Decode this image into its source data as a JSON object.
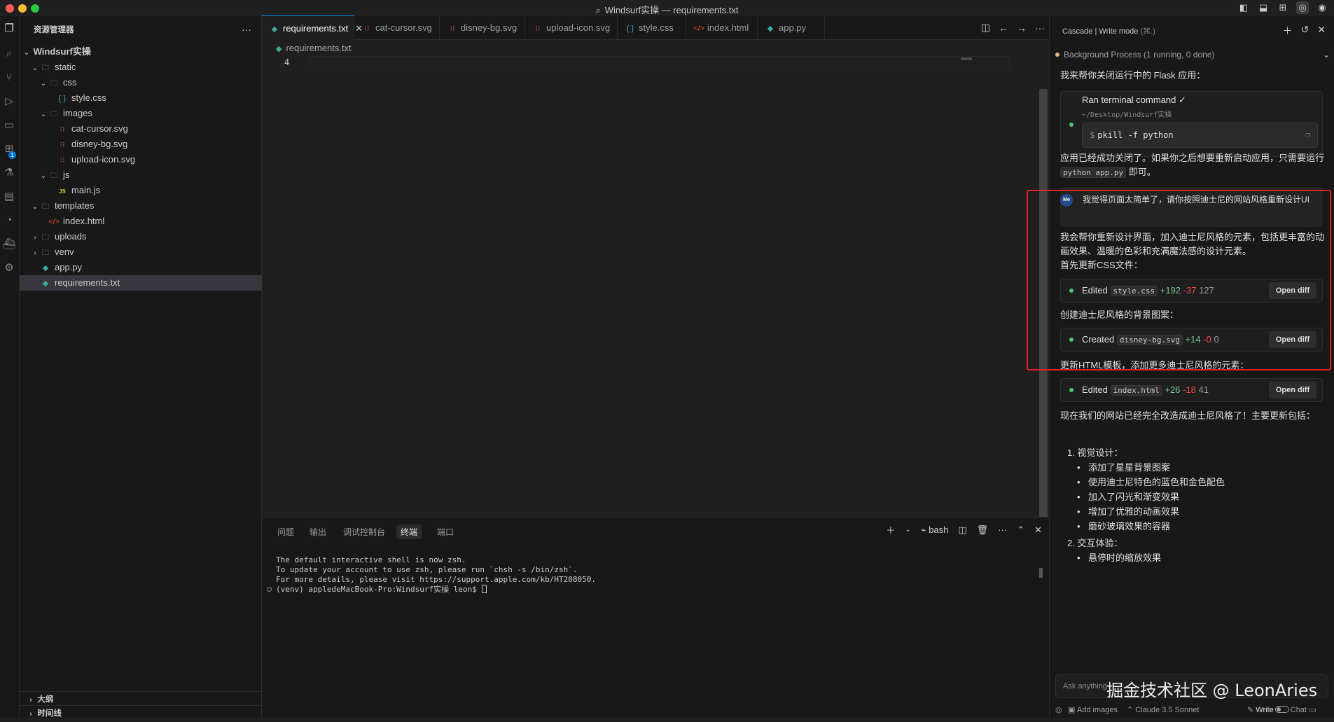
{
  "window": {
    "title": "Windsurf实操 — requirements.txt",
    "traffic_colors": [
      "#ff5f57",
      "#febc2e",
      "#28c840"
    ]
  },
  "explorer": {
    "header": "资源管理器",
    "root": "Windsurf实操",
    "items": [
      {
        "label": "static",
        "type": "folder-open",
        "depth": 1
      },
      {
        "label": "css",
        "type": "folder-open",
        "depth": 2
      },
      {
        "label": "style.css",
        "type": "css",
        "depth": 3
      },
      {
        "label": "images",
        "type": "folder-open",
        "depth": 2
      },
      {
        "label": "cat-cursor.svg",
        "type": "svg",
        "depth": 3
      },
      {
        "label": "disney-bg.svg",
        "type": "svg",
        "depth": 3
      },
      {
        "label": "upload-icon.svg",
        "type": "svg",
        "depth": 3
      },
      {
        "label": "js",
        "type": "folder-open",
        "depth": 2
      },
      {
        "label": "main.js",
        "type": "js",
        "depth": 3
      },
      {
        "label": "templates",
        "type": "folder-open",
        "depth": 1
      },
      {
        "label": "index.html",
        "type": "html",
        "depth": 2
      },
      {
        "label": "uploads",
        "type": "folder-closed",
        "depth": 1
      },
      {
        "label": "venv",
        "type": "folder-closed",
        "depth": 1
      },
      {
        "label": "app.py",
        "type": "py",
        "depth": 1
      },
      {
        "label": "requirements.txt",
        "type": "py",
        "depth": 1,
        "selected": true
      }
    ],
    "outline": "大纲",
    "timeline": "时间线"
  },
  "tabs": [
    {
      "label": "requirements.txt",
      "icon": "py",
      "active": true
    },
    {
      "label": "cat-cursor.svg",
      "icon": "svg"
    },
    {
      "label": "disney-bg.svg",
      "icon": "svg"
    },
    {
      "label": "upload-icon.svg",
      "icon": "svg"
    },
    {
      "label": "style.css",
      "icon": "css"
    },
    {
      "label": "index.html",
      "icon": "html"
    },
    {
      "label": "app.py",
      "icon": "py"
    }
  ],
  "editor": {
    "breadcrumb": "requirements.txt",
    "line_number": "4"
  },
  "panel": {
    "tabs": [
      "问题",
      "输出",
      "调试控制台",
      "终端",
      "端口"
    ],
    "active_tab": "终端",
    "shell": "bash",
    "terminal_lines": [
      "The default interactive shell is now zsh.",
      "To update your account to use zsh, please run `chsh -s /bin/zsh`.",
      "For more details, please visit https://support.apple.com/kb/HT208050.",
      "(venv) appledeMacBook-Pro:Windsurf实操 leon$ "
    ]
  },
  "cascade": {
    "title": "Cascade | Write mode",
    "shortcut": "(⌘.)",
    "bg_process": "Background Process (1 running, 0 done)",
    "msg_close": "我来帮你关闭运行中的 Flask 应用：",
    "terminal_card": {
      "title": "Ran terminal command",
      "path": "~/Desktop/Windsurf实操",
      "prompt": "$",
      "command": "pkill -f python"
    },
    "msg_closed_a": "应用已经成功关闭了。如果你之后想要重新启动应用，只需要运行",
    "msg_closed_code": "python app.py",
    "msg_closed_b": "即可。",
    "user_avatar": "Me",
    "user_msg": "我觉得页面太简单了，请你按照迪士尼的网站风格重新设计UI",
    "msg_redesign": "我会帮你重新设计界面，加入迪士尼风格的元素，包括更丰富的动画效果、温暖的色彩和充满魔法感的设计元素。",
    "msg_css_first": "首先更新CSS文件：",
    "edits": [
      {
        "verb": "Edited",
        "file": "style.css",
        "plus": "+192",
        "minus": "-37",
        "count": "127",
        "button": "Open diff"
      },
      {
        "verb": "Created",
        "file": "disney-bg.svg",
        "plus": "+14",
        "minus": "-0",
        "count": "0",
        "button": "Open diff"
      },
      {
        "verb": "Edited",
        "file": "index.html",
        "plus": "+26",
        "minus": "-18",
        "count": "41",
        "button": "Open diff"
      }
    ],
    "msg_bg": "创建迪士尼风格的背景图案：",
    "msg_html": "更新HTML模板，添加更多迪士尼风格的元素：",
    "msg_summary": "现在我们的网站已经完全改造成迪士尼风格了！主要更新包括：",
    "summary_list": [
      {
        "heading": "1. 视觉设计：",
        "items": [
          "添加了星星背景图案",
          "使用迪士尼特色的蓝色和金色配色",
          "加入了闪光和渐变效果",
          "增加了优雅的动画效果",
          "磨砂玻璃效果的容器"
        ]
      },
      {
        "heading": "2. 交互体验：",
        "items": [
          "悬停时的缩放效果"
        ]
      }
    ],
    "ask_placeholder": "Ask anything",
    "watermark": "掘金技术社区 @ LeonAries",
    "add_images": "Add images",
    "model": "Claude 3.5 Sonnet",
    "write": "Write",
    "chat": "Chat"
  },
  "colors": {
    "accent": "#0078d4",
    "highlight": "#e0241f",
    "added": "#73c991",
    "removed": "#f14c4c"
  }
}
